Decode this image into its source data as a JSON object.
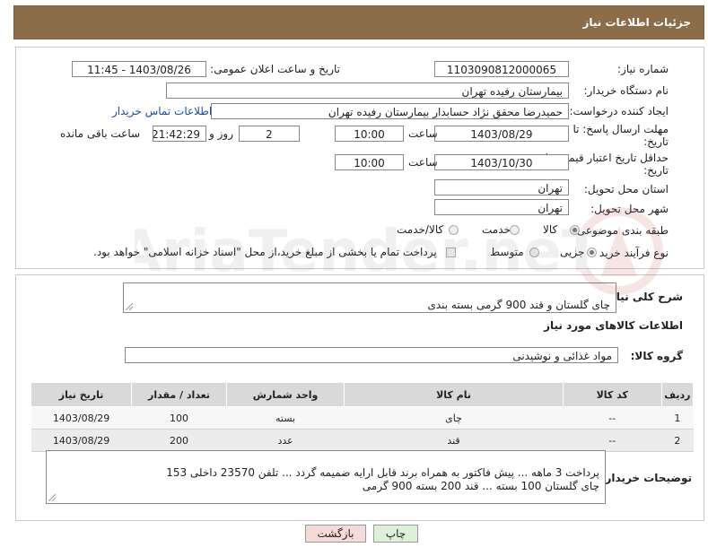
{
  "header": {
    "title": "جزئیات اطلاعات نیاز"
  },
  "form": {
    "need_number_label": "شماره نیاز:",
    "need_number": "1103090812000065",
    "announce_label": "تاریخ و ساعت اعلان عمومی:",
    "announce_value": "1403/08/26 - 11:45",
    "buyer_label": "نام دستگاه خریدار:",
    "buyer_value": "بیمارستان رفیده تهران",
    "creator_label": "ایجاد کننده درخواست:",
    "creator_value": "حمیدرضا  محقق نژاد حسابدار بیمارستان رفیده تهران",
    "contact_link": "اطلاعات تماس خریدار",
    "deadline_label_1": "مهلت ارسال پاسخ: تا",
    "deadline_label_2": "تاریخ:",
    "deadline_date": "1403/08/29",
    "time_label": "ساعت",
    "deadline_time": "10:00",
    "days_value": "2",
    "days_label": "روز و",
    "remain_time": "21:42:29",
    "remain_label": "ساعت باقی مانده",
    "validity_label_1": "حداقل تاریخ اعتبار قیمت: تا",
    "validity_label_2": "تاریخ:",
    "validity_date": "1403/10/30",
    "validity_time_label": "ساعت",
    "validity_time": "10:00",
    "province_label": "استان محل تحویل:",
    "province_value": "تهران",
    "city_label": "شهر محل تحویل:",
    "city_value": "تهران",
    "category_label": "طبقه بندی موضوعی:",
    "category_options": [
      "کالا",
      "خدمت",
      "کالا/خدمت"
    ],
    "process_label": "نوع فرآیند خرید :",
    "process_options": [
      "جزیی",
      "متوسط"
    ],
    "payment_note": "پرداخت تمام یا بخشی از مبلغ خرید،از محل \"اسناد خزانه اسلامی\" خواهد بود."
  },
  "description": {
    "label": "شرح کلی نیاز:",
    "value": "چای گلستان و قند 900 گرمی بسته بندی"
  },
  "goods_info": {
    "title": "اطلاعات کالاهای مورد نیاز"
  },
  "goods_group": {
    "label": "گروه کالا:",
    "value": "مواد غذائی و نوشیدنی"
  },
  "table": {
    "headers": [
      "ردیف",
      "کد کالا",
      "نام کالا",
      "واحد شمارش",
      "تعداد / مقدار",
      "تاریخ نیاز"
    ],
    "rows": [
      [
        "1",
        "--",
        "چای",
        "بسته",
        "100",
        "1403/08/29"
      ],
      [
        "2",
        "--",
        "قند",
        "عدد",
        "200",
        "1403/08/29"
      ]
    ]
  },
  "buyer_notes": {
    "label": "توضیحات خریدار:",
    "value": "پرداخت 3 ماهه ... پیش فاکتور به همراه برند قابل ارایه ضمیمه گردد ... تلفن 23570 داخلی 153\nچای گلستان  100 بسته ... قند 200 بسته 900 گرمی"
  },
  "buttons": {
    "print": "چاپ",
    "back": "بازگشت"
  },
  "colors": {
    "header": "#8b6d4a",
    "link": "#1a4fa0",
    "back_button": "#f6d9d9",
    "print_button": "#dff0d8"
  }
}
